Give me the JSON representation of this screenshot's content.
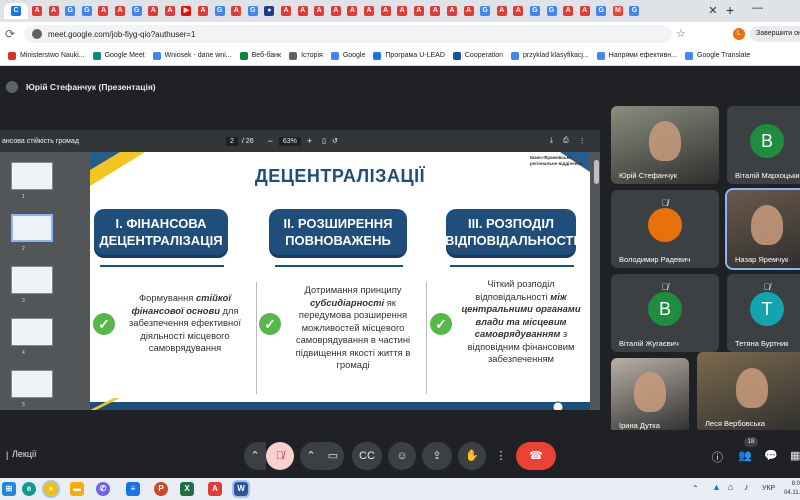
{
  "browser": {
    "tabs": [
      {
        "icon": "C",
        "color": "#1a73e8"
      },
      {
        "icon": "A",
        "color": "#e53935"
      },
      {
        "icon": "A",
        "color": "#e53935"
      },
      {
        "icon": "G",
        "color": "#4285f4"
      },
      {
        "icon": "G",
        "color": "#4285f4"
      },
      {
        "icon": "A",
        "color": "#e53935"
      },
      {
        "icon": "A",
        "color": "#e53935"
      },
      {
        "icon": "G",
        "color": "#4285f4"
      },
      {
        "icon": "A",
        "color": "#e53935"
      },
      {
        "icon": "A",
        "color": "#e53935"
      },
      {
        "icon": "▶",
        "color": "#ff0000"
      },
      {
        "icon": "A",
        "color": "#e53935"
      },
      {
        "icon": "G",
        "color": "#4285f4"
      },
      {
        "icon": "A",
        "color": "#e53935"
      },
      {
        "icon": "G",
        "color": "#4285f4"
      },
      {
        "icon": "●",
        "color": "#1e3a8a"
      },
      {
        "icon": "A",
        "color": "#e53935"
      },
      {
        "icon": "A",
        "color": "#e53935"
      },
      {
        "icon": "A",
        "color": "#e53935"
      },
      {
        "icon": "A",
        "color": "#e53935"
      },
      {
        "icon": "A",
        "color": "#e53935"
      },
      {
        "icon": "A",
        "color": "#e53935"
      },
      {
        "icon": "A",
        "color": "#e53935"
      },
      {
        "icon": "A",
        "color": "#e53935"
      },
      {
        "icon": "A",
        "color": "#e53935"
      },
      {
        "icon": "A",
        "color": "#e53935"
      },
      {
        "icon": "A",
        "color": "#e53935"
      },
      {
        "icon": "A",
        "color": "#e53935"
      },
      {
        "icon": "G",
        "color": "#4285f4"
      },
      {
        "icon": "A",
        "color": "#e53935"
      },
      {
        "icon": "A",
        "color": "#e53935"
      },
      {
        "icon": "G",
        "color": "#4285f4"
      },
      {
        "icon": "G",
        "color": "#4285f4"
      },
      {
        "icon": "A",
        "color": "#e53935"
      },
      {
        "icon": "A",
        "color": "#e53935"
      },
      {
        "icon": "G",
        "color": "#4285f4"
      },
      {
        "icon": "M",
        "color": "#ea4335"
      },
      {
        "icon": "G",
        "color": "#4285f4"
      }
    ],
    "url": "meet.google.com/job-fiyg-qio?authuser=1",
    "update_button": "Завершити оновле",
    "profile_initial": "L",
    "bookmarks": [
      {
        "label": "Ministerstwo Nauki...",
        "color": "#d93025"
      },
      {
        "label": "Google Meet",
        "color": "#00897b"
      },
      {
        "label": "Wniosek - dane wni...",
        "color": "#4285f4"
      },
      {
        "label": "Веб-банк",
        "color": "#0b8043"
      },
      {
        "label": "Історія",
        "color": "#5f6368"
      },
      {
        "label": "Google",
        "color": "#4285f4"
      },
      {
        "label": "Програма U-LEAD",
        "color": "#1a73e8"
      },
      {
        "label": "Cooperation",
        "color": "#174ea6"
      },
      {
        "label": "przyklad klasyfikacj...",
        "color": "#4285f4"
      },
      {
        "label": "Напрями ефективн...",
        "color": "#4285f4"
      },
      {
        "label": "Google Translate",
        "color": "#4285f4"
      }
    ]
  },
  "meet": {
    "presenter_label": "Юрій Стефанчук (Презентація)",
    "pdf": {
      "title": "ансова стійкість громад",
      "page_current": "2",
      "page_total": "/ 26",
      "zoom": "63%",
      "thumb_numbers": [
        "1",
        "2",
        "3",
        "4",
        "5"
      ],
      "slide": {
        "org_line1": "Івано-Франківське",
        "org_line2": "регіональне відділення",
        "heading": "ДЕЦЕНТРАЛІЗАЦІЇ",
        "boxes": [
          {
            "line1": "І. ФІНАНСОВА",
            "line2": "ДЕЦЕНТРАЛІЗАЦІЯ"
          },
          {
            "line1": "ІІ. РОЗШИРЕННЯ",
            "line2": "ПОВНОВАЖЕНЬ"
          },
          {
            "line1": "ІІІ. РОЗПОДІЛ",
            "line2": "ВІДПОВІДАЛЬНОСТІ"
          }
        ],
        "col1": {
          "a": "Формування ",
          "b": "стійкої фінансової основи",
          "c": " для забезпечення ефективної діяльності місцевого самоврядування"
        },
        "col2": {
          "a": "Дотримання принципу ",
          "b": "субсидіарності",
          "c": " як передумова розширення можливостей місцевого самоврядування в частині підвищення якості життя в громаді"
        },
        "col3": {
          "a": "Чіткий розподіл відповідальності ",
          "b": "між центральними органами влади та місцевим самоврядуванням",
          "c": " з відповідним фінансовим забезпеченням"
        }
      }
    },
    "participants": [
      {
        "name": "Юрій Стефанчук",
        "type": "video"
      },
      {
        "name": "Віталій Мархоцький",
        "type": "letter",
        "letter": "В",
        "color": "#1e8e3e"
      },
      {
        "name": "Володимир Радевич",
        "type": "avatar"
      },
      {
        "name": "Назар Яремчук",
        "type": "video"
      },
      {
        "name": "Віталій Жугаєвич",
        "type": "letter",
        "letter": "В",
        "color": "#1e8e3e"
      },
      {
        "name": "Тетяна Буртник",
        "type": "letter",
        "letter": "Т",
        "color": "#12a4af"
      },
      {
        "name": "Ірина Дутка",
        "type": "video"
      },
      {
        "name": "Леся Вербовська",
        "type": "video"
      }
    ],
    "meeting_title": "Лекції",
    "participant_count": "18",
    "colors": {
      "end_call": "#ea4335",
      "mic_off": "#f9d0ce",
      "accent_blue": "#1e4e79",
      "check_green": "#56b848"
    }
  },
  "taskbar": {
    "lang": "УКР",
    "time": "8:0",
    "date": "04.11."
  }
}
